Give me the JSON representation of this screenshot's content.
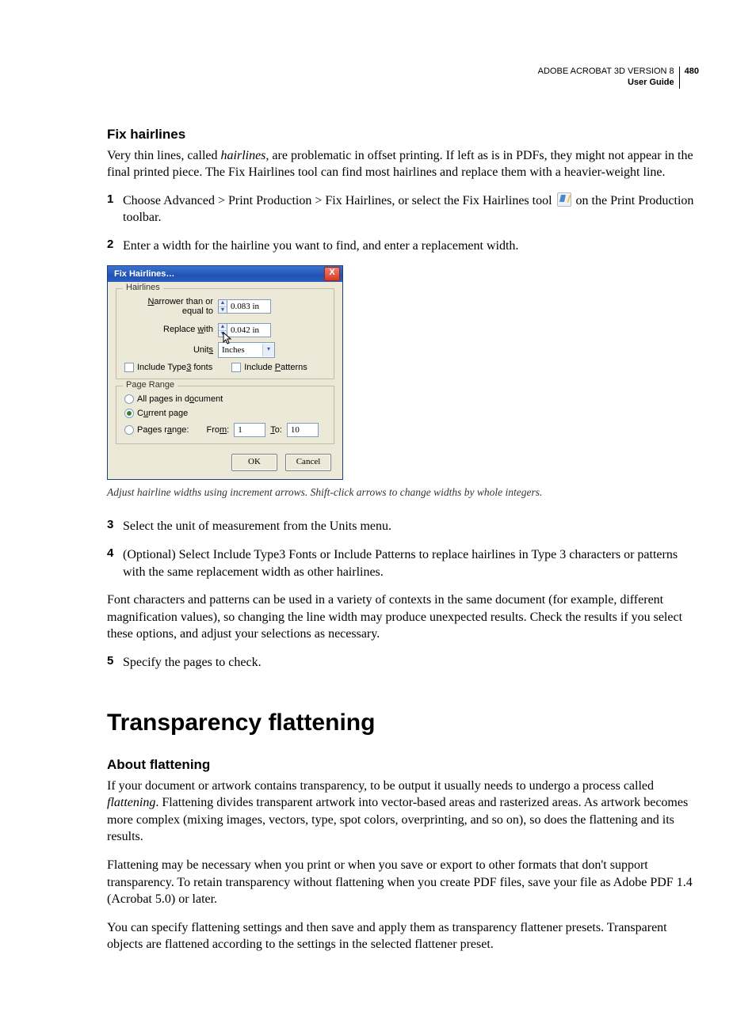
{
  "header": {
    "product": "ADOBE ACROBAT 3D VERSION 8",
    "doc": "User Guide",
    "page_number": "480"
  },
  "sec1": {
    "title": "Fix hairlines",
    "para1_a": "Very thin lines, called ",
    "para1_em": "hairlines,",
    "para1_b": " are problematic in offset printing. If left as is in PDFs, they might not appear in the final printed piece. The Fix Hairlines tool can find most hairlines and replace them with a heavier-weight line.",
    "step1_a": "Choose Advanced > Print Production > Fix Hairlines, or select the Fix Hairlines tool ",
    "step1_b": " on the Print Production toolbar.",
    "step2": "Enter a width for the hairline you want to find, and enter a replacement width.",
    "caption": "Adjust hairline widths using increment arrows. Shift-click arrows to change widths by whole integers.",
    "step3": "Select the unit of measurement from the Units menu.",
    "step4": "(Optional) Select Include Type3 Fonts or Include Patterns to replace hairlines in Type 3 characters or patterns with the same replacement width as other hairlines.",
    "para2": "Font characters and patterns can be used in a variety of contexts in the same document (for example, different magnification values), so changing the line width may produce unexpected results. Check the results if you select these options, and adjust your selections as necessary.",
    "step5": "Specify the pages to check."
  },
  "dialog": {
    "title": "Fix Hairlines…",
    "close": "X",
    "group_hairlines": "Hairlines",
    "lbl_narrower": "Narrower than or equal to",
    "lbl_narrower_accel": "N",
    "val_narrower": "0.083 in",
    "lbl_replace": "Replace ",
    "lbl_replace_accel": "w",
    "lbl_replace_suffix": "ith",
    "val_replace": "0.042 in",
    "lbl_units": "Unit",
    "lbl_units_accel": "s",
    "val_units": "Inches",
    "chk_type3": "Include Type",
    "chk_type3_accel": "3",
    "chk_type3_suffix": " fonts",
    "chk_patterns": "Include ",
    "chk_patterns_accel": "P",
    "chk_patterns_suffix": "atterns",
    "group_pr": "Page Range",
    "rad_all": "All pages in d",
    "rad_all_accel": "o",
    "rad_all_suffix": "cument",
    "rad_current": "C",
    "rad_current_accel": "u",
    "rad_current_suffix": "rrent page",
    "rad_range": "Pages r",
    "rad_range_accel": "a",
    "rad_range_suffix": "nge:",
    "lbl_from": "Fro",
    "lbl_from_accel": "m",
    "lbl_from_suffix": ":",
    "val_from": "1",
    "lbl_to_accel": "T",
    "lbl_to": "o:",
    "val_to": "10",
    "btn_ok": "OK",
    "btn_cancel": "Cancel"
  },
  "sec2": {
    "chapter": "Transparency flattening",
    "h": "About flattening",
    "p1_a": "If your document or artwork contains transparency, to be output it usually needs to undergo a process called ",
    "p1_em": "flattening",
    "p1_b": ". Flattening divides transparent artwork into vector-based areas and rasterized areas. As artwork becomes more complex (mixing images, vectors, type, spot colors, overprinting, and so on), so does the flattening and its results.",
    "p2": "Flattening may be necessary when you print or when you save or export to other formats that don't support transparency. To retain transparency without flattening when you create PDF files, save your file as Adobe PDF 1.4 (Acrobat 5.0) or later.",
    "p3": "You can specify flattening settings and then save and apply them as transparency flattener presets. Transparent objects are flattened according to the settings in the selected flattener preset."
  },
  "nums": {
    "n1": "1",
    "n2": "2",
    "n3": "3",
    "n4": "4",
    "n5": "5"
  }
}
